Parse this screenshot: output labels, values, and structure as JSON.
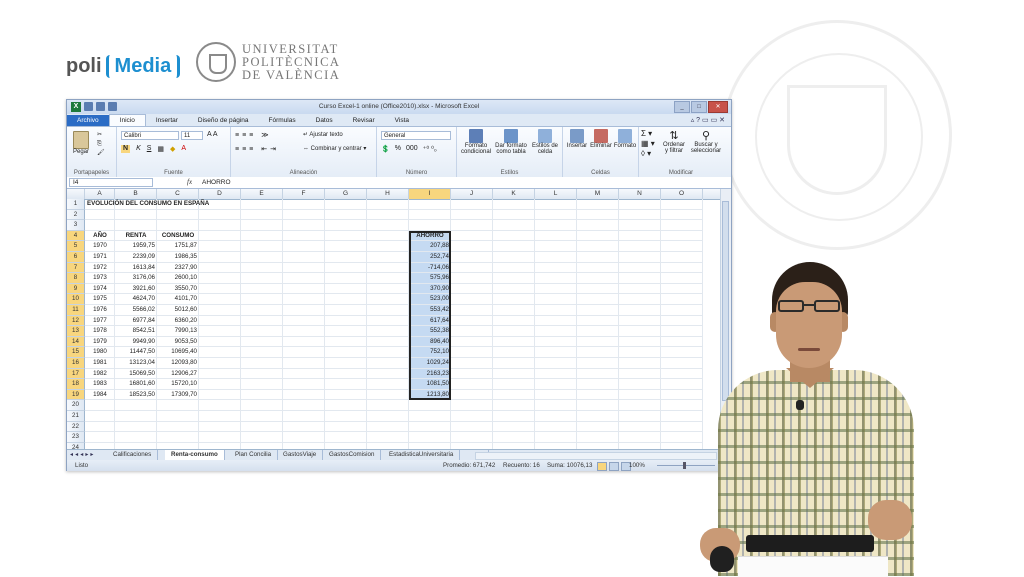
{
  "branding": {
    "poli": "poli",
    "media": "Media",
    "university_lines": [
      "UNIVERSITAT",
      "POLITÈCNICA",
      "DE VALÈNCIA"
    ]
  },
  "excel": {
    "window_title": "Curso Excel-1 online (Office2010).xlsx - Microsoft Excel",
    "tabs": [
      "Archivo",
      "Inicio",
      "Insertar",
      "Diseño de página",
      "Fórmulas",
      "Datos",
      "Revisar",
      "Vista"
    ],
    "active_tab": "Inicio",
    "ribbon": {
      "clipboard": {
        "paste_label": "Pegar",
        "group": "Portapapeles"
      },
      "font": {
        "font_name": "Calibri",
        "font_size": "11",
        "bold": "N",
        "italic": "K",
        "underline": "S",
        "group": "Fuente"
      },
      "alignment": {
        "wrap_text": "Ajustar texto",
        "merge_center": "Combinar y centrar",
        "group": "Alineación"
      },
      "number": {
        "format": "General",
        "percent": "%",
        "thousands": "000",
        "group": "Número"
      },
      "styles": {
        "conditional": [
          "Formato",
          "condicional"
        ],
        "table": [
          "Dar formato",
          "como tabla"
        ],
        "cell_styles": [
          "Estilos de",
          "celda"
        ],
        "group": "Estilos"
      },
      "cells": {
        "insert": "Insertar",
        "delete": "Eliminar",
        "format": "Formato",
        "group": "Celdas"
      },
      "editing": {
        "sort": [
          "Ordenar",
          "y filtrar"
        ],
        "find": [
          "Buscar y",
          "seleccionar"
        ],
        "group": "Modificar"
      }
    },
    "formula_bar": {
      "name_box": "I4",
      "fx": "fx",
      "content": "AHORRO"
    },
    "columns": [
      "A",
      "B",
      "C",
      "D",
      "E",
      "F",
      "G",
      "H",
      "I",
      "J",
      "K",
      "L",
      "M",
      "N",
      "O"
    ],
    "selected_column": "I",
    "row_numbers": [
      "1",
      "2",
      "3",
      "4",
      "5",
      "6",
      "7",
      "8",
      "9",
      "10",
      "11",
      "12",
      "13",
      "14",
      "15",
      "16",
      "17",
      "18",
      "19",
      "20",
      "21",
      "22",
      "23",
      "24"
    ],
    "sheet_title": "EVOLUCIÓN DEL CONSUMO EN ESPAÑA",
    "table_headers": {
      "year": "AÑO",
      "income": "RENTA",
      "consumption": "CONSUMO",
      "savings": "AHORRO"
    },
    "table_rows": [
      {
        "year": "1970",
        "renta": "1959,75",
        "consumo": "1751,87",
        "ahorro": "207,88"
      },
      {
        "year": "1971",
        "renta": "2239,09",
        "consumo": "1986,35",
        "ahorro": "252,74"
      },
      {
        "year": "1972",
        "renta": "1613,84",
        "consumo": "2327,90",
        "ahorro": "-714,06"
      },
      {
        "year": "1973",
        "renta": "3176,06",
        "consumo": "2600,10",
        "ahorro": "575,96"
      },
      {
        "year": "1974",
        "renta": "3921,60",
        "consumo": "3550,70",
        "ahorro": "370,90"
      },
      {
        "year": "1975",
        "renta": "4624,70",
        "consumo": "4101,70",
        "ahorro": "523,00"
      },
      {
        "year": "1976",
        "renta": "5566,02",
        "consumo": "5012,60",
        "ahorro": "553,42"
      },
      {
        "year": "1977",
        "renta": "6977,84",
        "consumo": "6360,20",
        "ahorro": "617,64"
      },
      {
        "year": "1978",
        "renta": "8542,51",
        "consumo": "7990,13",
        "ahorro": "552,38"
      },
      {
        "year": "1979",
        "renta": "9949,90",
        "consumo": "9053,50",
        "ahorro": "896,40"
      },
      {
        "year": "1980",
        "renta": "11447,50",
        "consumo": "10695,40",
        "ahorro": "752,10"
      },
      {
        "year": "1981",
        "renta": "13123,04",
        "consumo": "12093,80",
        "ahorro": "1029,24"
      },
      {
        "year": "1982",
        "renta": "15069,50",
        "consumo": "12906,27",
        "ahorro": "2163,23"
      },
      {
        "year": "1983",
        "renta": "16801,60",
        "consumo": "15720,10",
        "ahorro": "1081,50"
      },
      {
        "year": "1984",
        "renta": "18523,50",
        "consumo": "17309,70",
        "ahorro": "1213,80"
      }
    ],
    "sheet_tabs": [
      "Calificaciones",
      "Renta-consumo",
      "Plan Concilia",
      "GastosViaje",
      "GastosComision",
      "EstadisticaUniversitaria"
    ],
    "active_sheet": "Renta-consumo",
    "status": {
      "ready": "Listo",
      "average": "Promedio: 671,742",
      "count": "Recuento: 16",
      "sum": "Suma: 10076,13",
      "zoom": "100%"
    },
    "colors": {
      "file_tab": "#2b6cc5",
      "selection": "#c5daf2",
      "header_highlight": "#f8d67e"
    }
  }
}
